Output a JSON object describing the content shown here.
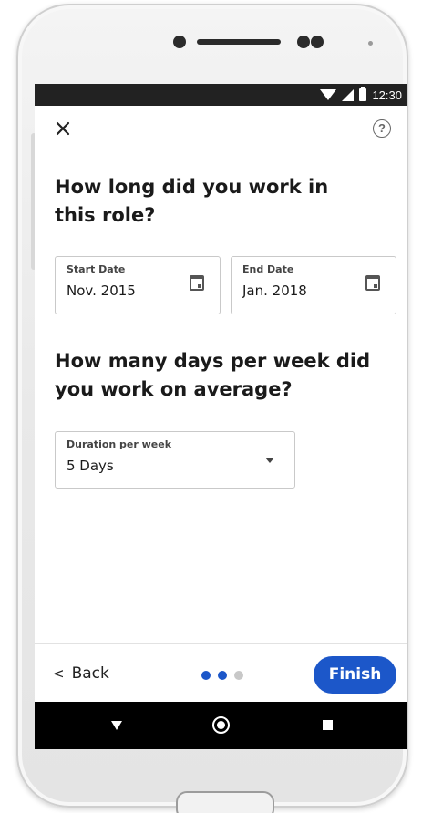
{
  "status_bar": {
    "time": "12:30"
  },
  "header": {
    "close_icon": "close-icon",
    "help_icon": "help-circle-icon",
    "help_glyph": "?"
  },
  "questions": {
    "work_duration": "How long did you work in this role?",
    "days_per_week": "How many days per week did you work on average?"
  },
  "fields": {
    "start_date": {
      "label": "Start Date",
      "value": "Nov. 2015",
      "icon": "calendar-icon"
    },
    "end_date": {
      "label": "End Date",
      "value": "Jan. 2018",
      "icon": "calendar-icon"
    },
    "duration": {
      "label": "Duration per week",
      "value": "5 Days",
      "icon": "dropdown-caret-icon"
    }
  },
  "footer": {
    "back_label": "Back",
    "back_glyph": "<",
    "finish_label": "Finish",
    "steps": {
      "total": 3,
      "completed": 2
    },
    "colors": {
      "accent": "#1c57c9",
      "dot_inactive": "#c8c8c8"
    }
  },
  "nav": {
    "back_icon": "nav-back-icon",
    "home_icon": "nav-home-icon",
    "recent_icon": "nav-recent-icon"
  }
}
